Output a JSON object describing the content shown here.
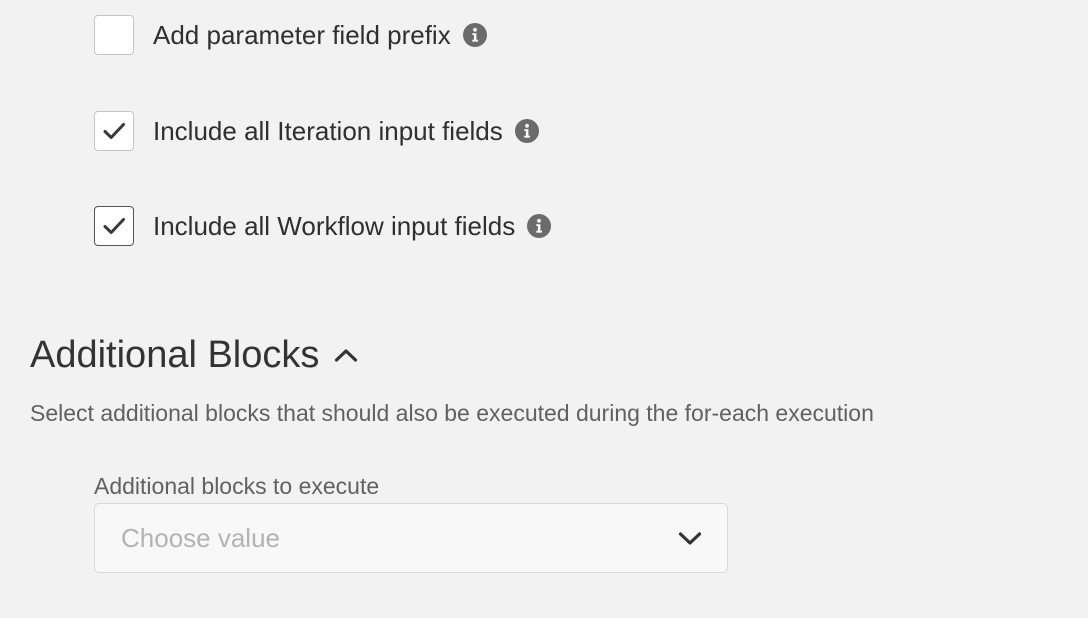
{
  "options": {
    "items": [
      {
        "label": "Add parameter field prefix",
        "checked": false,
        "icon": "info-icon"
      },
      {
        "label": "Include all Iteration input fields",
        "checked": true,
        "icon": "info-icon"
      },
      {
        "label": "Include all Workflow input fields",
        "checked": true,
        "icon": "info-icon"
      }
    ]
  },
  "additional_blocks": {
    "title": "Additional Blocks",
    "title_icon": "chevron-up-icon",
    "description": "Select additional blocks that should also be executed during the for-each execution",
    "field_label": "Additional blocks to execute",
    "select": {
      "placeholder": "Choose value",
      "icon": "chevron-down-icon"
    }
  },
  "colors": {
    "background": "#f2f2f2",
    "text": "#333333",
    "muted_text": "#616161",
    "placeholder": "#b3b3b3",
    "icon": "#6b6b6b"
  }
}
